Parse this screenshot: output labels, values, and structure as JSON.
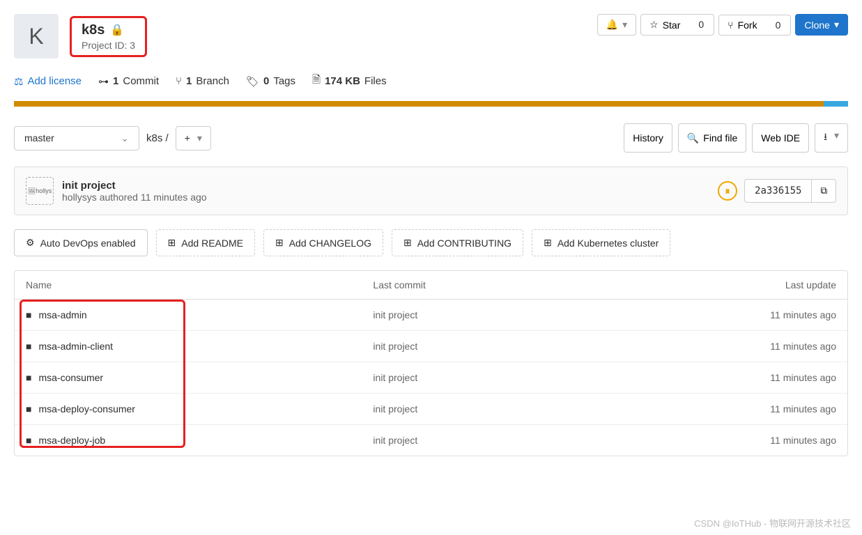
{
  "project": {
    "avatar_letter": "K",
    "name": "k8s",
    "id_label": "Project ID: 3"
  },
  "actions": {
    "star_label": "Star",
    "star_count": "0",
    "fork_label": "Fork",
    "fork_count": "0",
    "clone_label": "Clone"
  },
  "stats": {
    "license": "Add license",
    "commits_count": "1",
    "commits_label": "Commit",
    "branches_count": "1",
    "branches_label": "Branch",
    "tags_count": "0",
    "tags_label": "Tags",
    "size": "174 KB",
    "size_label": "Files"
  },
  "branch": {
    "selected": "master",
    "breadcrumb": "k8s",
    "sep": "/"
  },
  "buttons": {
    "history": "History",
    "find_file": "Find file",
    "web_ide": "Web IDE"
  },
  "commit": {
    "avatar_alt": "hollys",
    "message": "init project",
    "author": "hollysys",
    "authored": "authored",
    "time": "11 minutes ago",
    "sha": "2a336155"
  },
  "suggestions": {
    "devops": "Auto DevOps enabled",
    "readme": "Add README",
    "changelog": "Add CHANGELOG",
    "contributing": "Add CONTRIBUTING",
    "kubernetes": "Add Kubernetes cluster"
  },
  "table": {
    "headers": {
      "name": "Name",
      "commit": "Last commit",
      "update": "Last update"
    },
    "rows": [
      {
        "name": "msa-admin",
        "commit": "init project",
        "update": "11 minutes ago"
      },
      {
        "name": "msa-admin-client",
        "commit": "init project",
        "update": "11 minutes ago"
      },
      {
        "name": "msa-consumer",
        "commit": "init project",
        "update": "11 minutes ago"
      },
      {
        "name": "msa-deploy-consumer",
        "commit": "init project",
        "update": "11 minutes ago"
      },
      {
        "name": "msa-deploy-job",
        "commit": "init project",
        "update": "11 minutes ago"
      }
    ]
  },
  "watermark": "CSDN @IoTHub - 物联网开源技术社区"
}
